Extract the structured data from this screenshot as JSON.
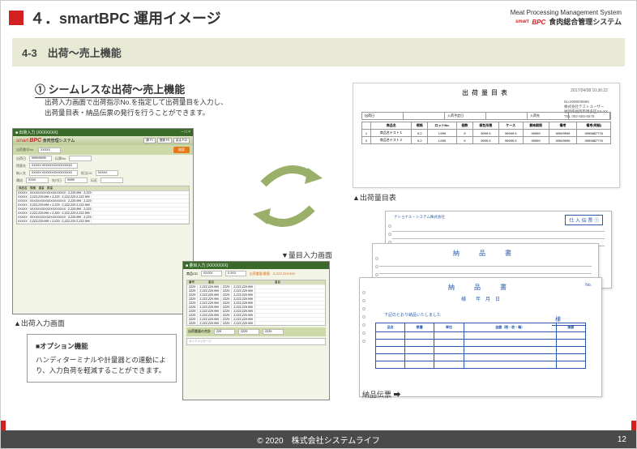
{
  "header": {
    "title": "４．smartBPC 運用イメージ",
    "system_name_en": "Meat Processing Management System",
    "logo_smart": "smart",
    "logo_bpc": "BPC",
    "system_name_jp": "食肉総合管理システム"
  },
  "section": {
    "label": "4-3　出荷～売上機能"
  },
  "feature": {
    "title": "① シームレスな出荷～売上機能",
    "desc_l1": "出荷入力画面で出荷指示No.を指定して出荷量目を入力し、",
    "desc_l2": "出荷量目表・納品伝票の発行を行うことができます。"
  },
  "app1": {
    "titlebar": "■ 出荷入力 (XXXXXXX)",
    "brand_smart": "smart",
    "brand_bpc": "BPC",
    "brand_sys": "食肉管理システム",
    "toolbar": {
      "lbl1": "出荷番号No",
      "btn": "検索"
    },
    "caption": "▲出荷入力画面"
  },
  "app2": {
    "titlebar": "■ 量目入力 (XXXXXXX)",
    "header_sum": "出荷重量/重量　Z,ZZZ,ZZ9.999",
    "grid_cols": [
      "番号",
      "量目",
      "",
      "量目"
    ],
    "grid_sample": "Z,ZZZ,ZZ9.999",
    "footer_lbl": "出荷重量の合計",
    "msg": "ガイドメッセージ",
    "caption": "▼量目入力画面"
  },
  "option_box": {
    "title": "■オプション機能",
    "text": "ハンディターミナルや計量器との連動により、入力負荷を軽減することができます。"
  },
  "doc1": {
    "title": "出荷量目表",
    "date": "2017/04/08   10:36:22",
    "addr_l1": "No.0099/09999",
    "addr_l2": "株式会社テストユーザー",
    "addr_l3": "福岡県福岡市博多区XX-XX",
    "addr_l4": "TEL 092-555-5578",
    "head": [
      "出荷日",
      "",
      "入荷予定日",
      "",
      "入荷先",
      "",
      "",
      ""
    ],
    "cols": [
      "",
      "商品名",
      "規格",
      "ロットNo.",
      "個数",
      "梱包形態",
      "ケース",
      "賞味期限",
      "備考",
      "備考(明細)"
    ],
    "rows": [
      [
        "1",
        "商品名テスト１",
        "9.2",
        "L999",
        "9",
        "9999.9",
        "99999.9",
        "99999",
        "9/99/9999",
        "9999887776"
      ],
      [
        "2",
        "商品名テスト２",
        "9.2",
        "L999",
        "9",
        "9999.9",
        "99999.9",
        "99999",
        "9/99/9999",
        "9999887776"
      ]
    ],
    "caption": "▲出荷量目表"
  },
  "docstack": {
    "a": {
      "label_left": "ナショナル・システム株式会社",
      "label_right": "仕 入 伝 票 ①"
    },
    "b": {
      "title": "納　品　書"
    },
    "c": {
      "title": "納　品　書",
      "sub": "下記のとおり納品いたしました",
      "cols": [
        "品名",
        "数量",
        "単位",
        "金額（税・枚・箱）",
        "摘要"
      ]
    },
    "caption": "納品伝票 ➡"
  },
  "footer": {
    "copyright": "© 2020　株式会社システムライフ",
    "page": "12"
  },
  "chart_data": null
}
